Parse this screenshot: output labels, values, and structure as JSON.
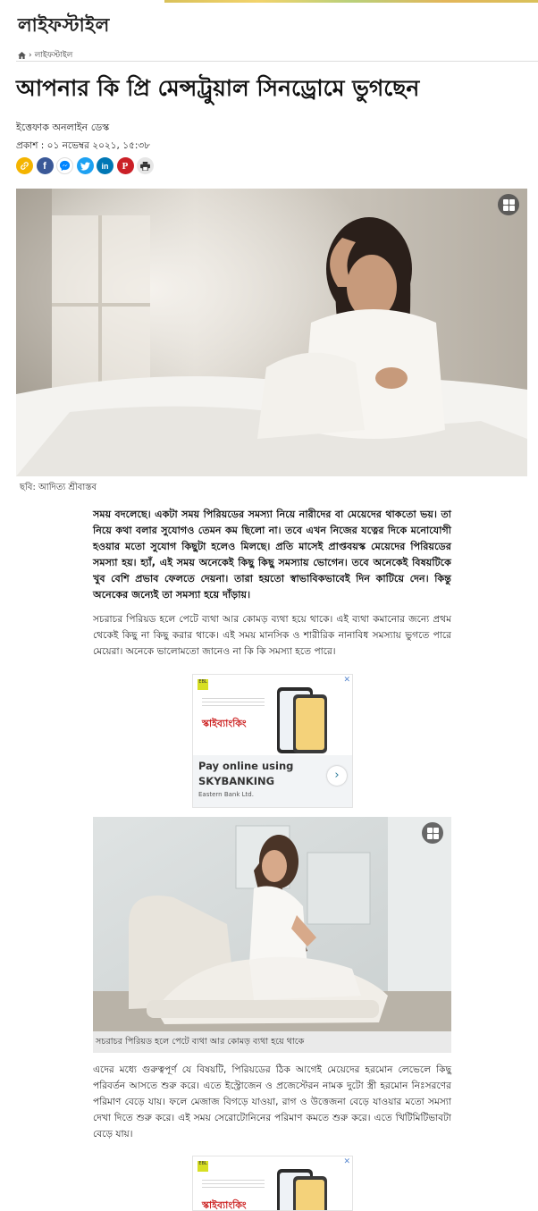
{
  "section": {
    "name": "লাইফস্টাইল"
  },
  "breadcrumb": {
    "home_icon": "home-icon",
    "separator": "›",
    "current": "লাইফস্টাইল"
  },
  "article": {
    "headline": "আপনার কি প্রি মেন্সট্রুয়াল সিনড্রোমে ভুগছেন",
    "author": "ইত্তেফাক অনলাইন ডেস্ক",
    "published": "প্রকাশ : ০১ নভেম্বর ২০২১, ১৫:৩৮",
    "image1_caption": "ছবি: আদিত্য শ্রীবাস্তব",
    "lead": "সময় বদলেছে। একটা সময় পিরিয়ডের সমস্যা নিয়ে নারীদের বা মেয়েদের থাকতো ভয়। তা নিয়ে কথা বলার সুযোগও তেমন কম ছিলো না। তবে এখন নিজের যত্নের দিকে মনোযোগী হওয়ার মতো সুযোগ কিছুটা হলেও মিলছে। প্রতি মাসেই প্রাপ্তবয়স্ক মেয়েদের পিরিয়ডের সমস্যা হয়। হ্যাঁ, এই সময় অনেকেই কিছু কিছু সমস্যায় ভোগেন। তবে অনেকেই বিষয়টিকে খুব বেশি প্রভাব ফেলতে দেয়না। তারা হয়তো স্বাভাবিকভাবেই দিন কাটিয়ে দেন। কিন্তু অনেকের জন্যেই তা সমস্যা হয়ে দাঁড়ায়।",
    "paragraph1": "সচরাচর পিরিয়ড হলে পেটে ব্যথা আর কোমড় ব্যথা হয়ে থাকে। এই ব্যথা কমানোর জন্যে প্রথম থেকেই কিছু না কিছু করার থাকে। এই সময় মানসিক ও শারীরিক নানাবিধ সমস্যায় ভুগতে পারে মেয়েরা। অনেকে ভালোমতো জানেও না কি কি সমস্যা হতে পারে।",
    "image2_caption": "সচরাচর পিরিয়ড হলে পেটে ব্যথা আর কোমড় ব্যথা হয়ে থাকে",
    "paragraph2": "এদের মধ্যে গুরুত্বপূর্ণ যে বিষয়টি, পিরিয়ডের ঠিক আগেই মেয়েদের হরমোন লেভেলে কিছু পরিবর্তন আসতে শুরু করে। এতে ইস্ট্রোজেন ও প্রজেস্টেরন নামক দুটো স্ত্রী হরমোন নিঃসরণের পরিমাণ বেড়ে যায়। ফলে মেজাজ বিগড়ে যাওয়া, রাগ ও উত্তেজনা বেড়ে যাওয়ার মতো সমস্যা দেখা দিতে শুরু করে। এই সময় সেরোটোনিনের পরিমাণ কমতে শুরু করে। এতে খিটিমিটিভাবটা বেড়ে যায়।"
  },
  "share": [
    {
      "icon": "link-icon",
      "color": "#f4b400",
      "glyph": "🔗"
    },
    {
      "icon": "facebook-icon",
      "color": "#3b5998",
      "glyph": "f"
    },
    {
      "icon": "messenger-icon",
      "color": "#ffffff",
      "glyph": "⚡"
    },
    {
      "icon": "twitter-icon",
      "color": "#1da1f2",
      "glyph": "t"
    },
    {
      "icon": "linkedin-icon",
      "color": "#0077b5",
      "glyph": "in"
    },
    {
      "icon": "pinterest-icon",
      "color": "#cb2027",
      "glyph": "P"
    },
    {
      "icon": "print-icon",
      "color": "#e6e6e6",
      "glyph": "⎙"
    }
  ],
  "ad": {
    "close": "✕",
    "title_bn": "স্কাইব্যাংকিং",
    "cta_line1": "Pay online using",
    "cta_line2": "SKYBANKING",
    "bank": "Eastern Bank Ltd.",
    "arrow": "›"
  },
  "colors": {
    "accent": "#d7df23",
    "link": "#3b5998"
  }
}
